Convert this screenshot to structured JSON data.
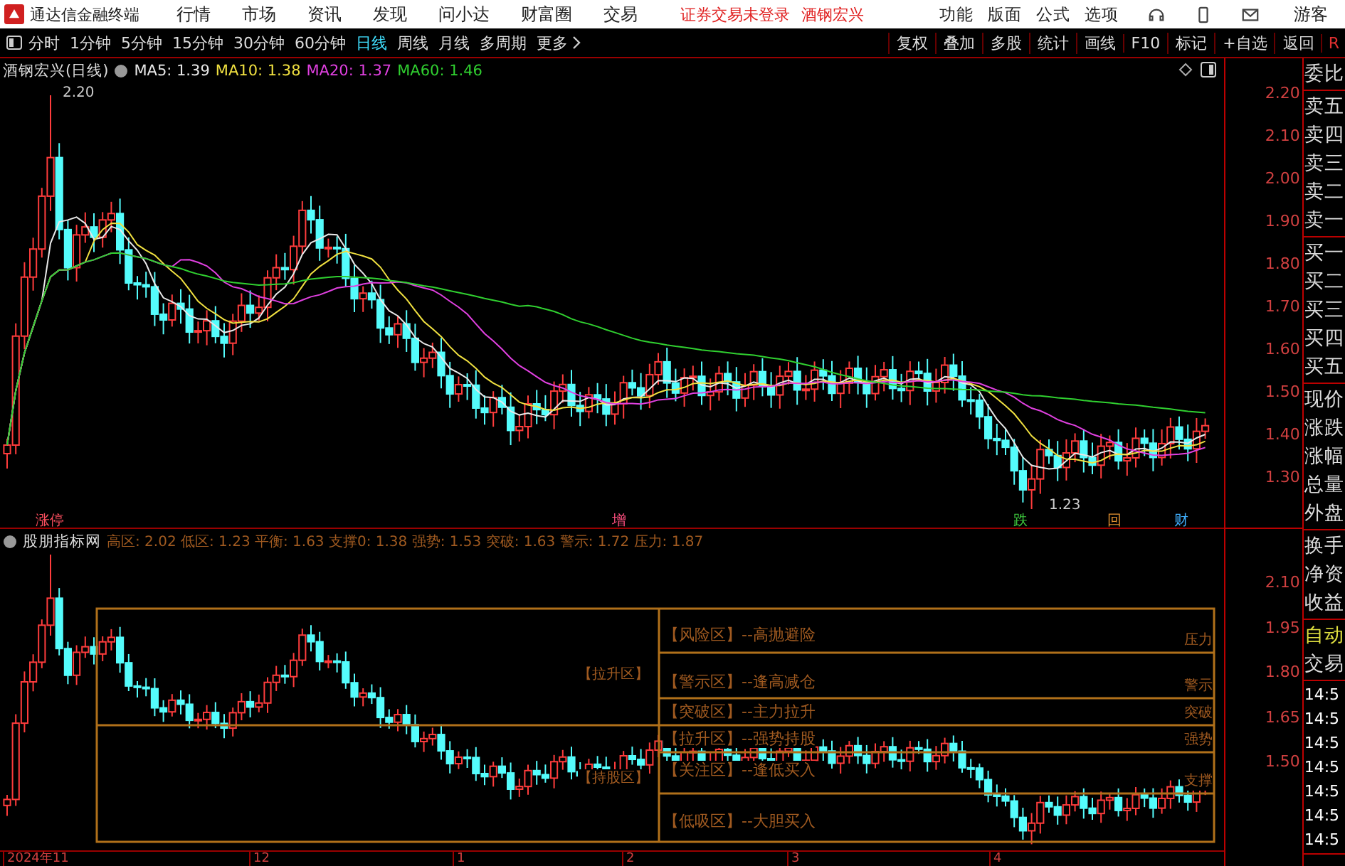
{
  "menu_bar": {
    "app_name": "通达信金融终端",
    "menus": [
      "行情",
      "市场",
      "资讯",
      "发现",
      "问小达",
      "财富圈",
      "交易"
    ],
    "login_status": "证券交易未登录",
    "stock": "酒钢宏兴",
    "tools": [
      "功能",
      "版面",
      "公式",
      "选项"
    ],
    "user": "游客"
  },
  "toolbar": {
    "periods": [
      {
        "label": "分时",
        "selected": false
      },
      {
        "label": "1分钟",
        "selected": false
      },
      {
        "label": "5分钟",
        "selected": false
      },
      {
        "label": "15分钟",
        "selected": false
      },
      {
        "label": "30分钟",
        "selected": false
      },
      {
        "label": "60分钟",
        "selected": false
      },
      {
        "label": "日线",
        "selected": true
      },
      {
        "label": "周线",
        "selected": false
      },
      {
        "label": "月线",
        "selected": false
      },
      {
        "label": "多周期",
        "selected": false
      },
      {
        "label": "更多",
        "selected": false
      }
    ],
    "actions": [
      "复权",
      "叠加",
      "多股",
      "统计",
      "画线",
      "F10",
      "标记",
      "+自选",
      "返回"
    ],
    "corner": "R"
  },
  "price_chart": {
    "title": "酒钢宏兴(日线)",
    "moving_averages": [
      {
        "label": "MA5: 1.39",
        "color": "#e8e8e8"
      },
      {
        "label": "MA10: 1.38",
        "color": "#f0e040"
      },
      {
        "label": "MA20: 1.37",
        "color": "#e040e0"
      },
      {
        "label": "MA60: 1.46",
        "color": "#30d030"
      }
    ],
    "high_label": "2.20",
    "low_label": "1.23",
    "y_ticks": [
      "2.20",
      "2.10",
      "2.00",
      "1.90",
      "1.80",
      "1.70",
      "1.60",
      "1.50",
      "1.40",
      "1.30"
    ],
    "markers": [
      {
        "label": "涨停",
        "color": "#ff5060"
      },
      {
        "label": "增",
        "color": "#ff5080"
      },
      {
        "label": "跌",
        "color": "#40d040"
      },
      {
        "label": "回",
        "color": "#e09030"
      },
      {
        "label": "财",
        "color": "#40b0ff"
      }
    ]
  },
  "indicator": {
    "name": "股朋指标网",
    "values": "高区: 2.02 低区: 1.23 平衡: 1.63 支撑0: 1.38 强势: 1.53 突破: 1.63 警示: 1.72 压力: 1.87",
    "zones": [
      "【风险区】--高抛避险",
      "【警示区】--逢高减仓",
      "【突破区】--主力拉升",
      "【拉升区】--强势持股",
      "【关注区】--逢低买入",
      "【低吸区】--大胆买入"
    ],
    "side_labels": [
      "【拉升区】",
      "【持股区】"
    ],
    "levels": [
      "压力",
      "警示",
      "突破",
      "强势",
      "支撑"
    ],
    "y_ticks": [
      "2.10",
      "1.95",
      "1.80",
      "1.65",
      "1.50"
    ]
  },
  "date_axis": [
    "2024年11",
    "12",
    "1",
    "2",
    "3",
    "4"
  ],
  "quote_panel": {
    "groups": [
      [
        "委比"
      ],
      [
        "卖五",
        "卖四",
        "卖三",
        "卖二",
        "卖一"
      ],
      [
        "买一",
        "买二",
        "买三",
        "买四",
        "买五"
      ],
      [
        "现价",
        "涨跌",
        "涨幅",
        "总量",
        "外盘"
      ],
      [
        "换手",
        "净资",
        "收益"
      ]
    ],
    "mode": "自动",
    "trade": "交易",
    "times": [
      "14:5",
      "14:5",
      "14:5",
      "14:5",
      "14:5",
      "14:5",
      "14:5"
    ]
  }
}
